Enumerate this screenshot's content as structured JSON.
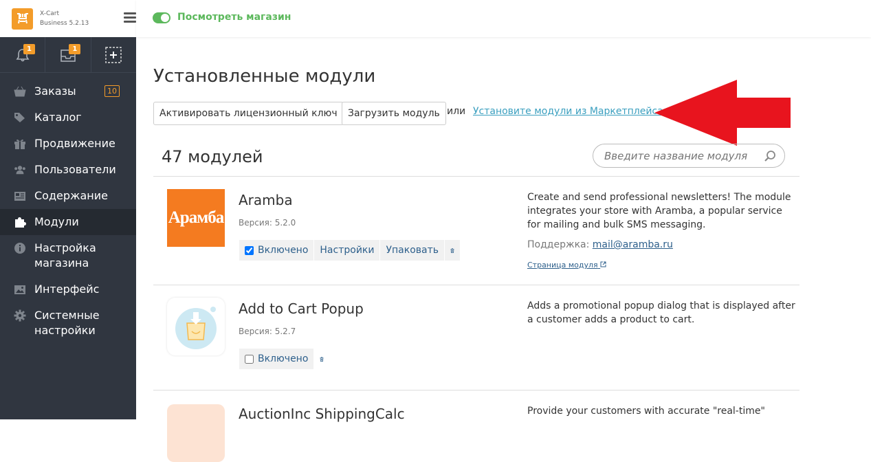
{
  "brand": {
    "name": "X-Cart",
    "edition": "Business 5.2.13"
  },
  "quick_badges": {
    "notifications": "1",
    "orders": "1"
  },
  "topbar": {
    "view_store": "Посмотреть магазин"
  },
  "nav": {
    "items": [
      {
        "label": "Заказы",
        "badge": "10"
      },
      {
        "label": "Каталог"
      },
      {
        "label": "Продвижение"
      },
      {
        "label": "Пользователи"
      },
      {
        "label": "Содержание"
      },
      {
        "label": "Модули"
      },
      {
        "label": "Настройка",
        "label2": "магазина"
      },
      {
        "label": "Интерфейс"
      },
      {
        "label": "Системные",
        "label2": "настройки"
      }
    ]
  },
  "main": {
    "title": "Установленные модули",
    "activate_key": "Активировать лицензионный ключ",
    "upload_module": "Загрузить модуль",
    "or": "или",
    "marketplace_link": "Установите модули из Маркетплейса",
    "count": "47 модулей",
    "search_placeholder": "Введите название модуля"
  },
  "modules": [
    {
      "name": "Aramba",
      "version": "Версия: 5.2.0",
      "logo_text": "Арамба",
      "enabled_label": "Включено",
      "settings_label": "Настройки",
      "pack_label": "Упаковать",
      "enabled": true,
      "description": "Create and send professional newsletters! The module integrates your store with Aramba, a popular service for mailing and bulk SMS messaging.",
      "support_label": "Поддержка:",
      "support_email": "mail@aramba.ru",
      "page_link": "Страница модуля"
    },
    {
      "name": "Add to Cart Popup",
      "version": "Версия: 5.2.7",
      "enabled_label": "Включено",
      "enabled": false,
      "description": "Adds a promotional popup dialog that is displayed after a customer adds a product to cart."
    },
    {
      "name": "AuctionInc ShippingCalc",
      "description": "Provide your customers with accurate \"real-time\""
    }
  ],
  "colors": {
    "sidebar": "#303640",
    "accent": "#f39c2a",
    "green": "#5cb85c",
    "link": "#3a9fbf",
    "arrow": "#e8141e"
  }
}
